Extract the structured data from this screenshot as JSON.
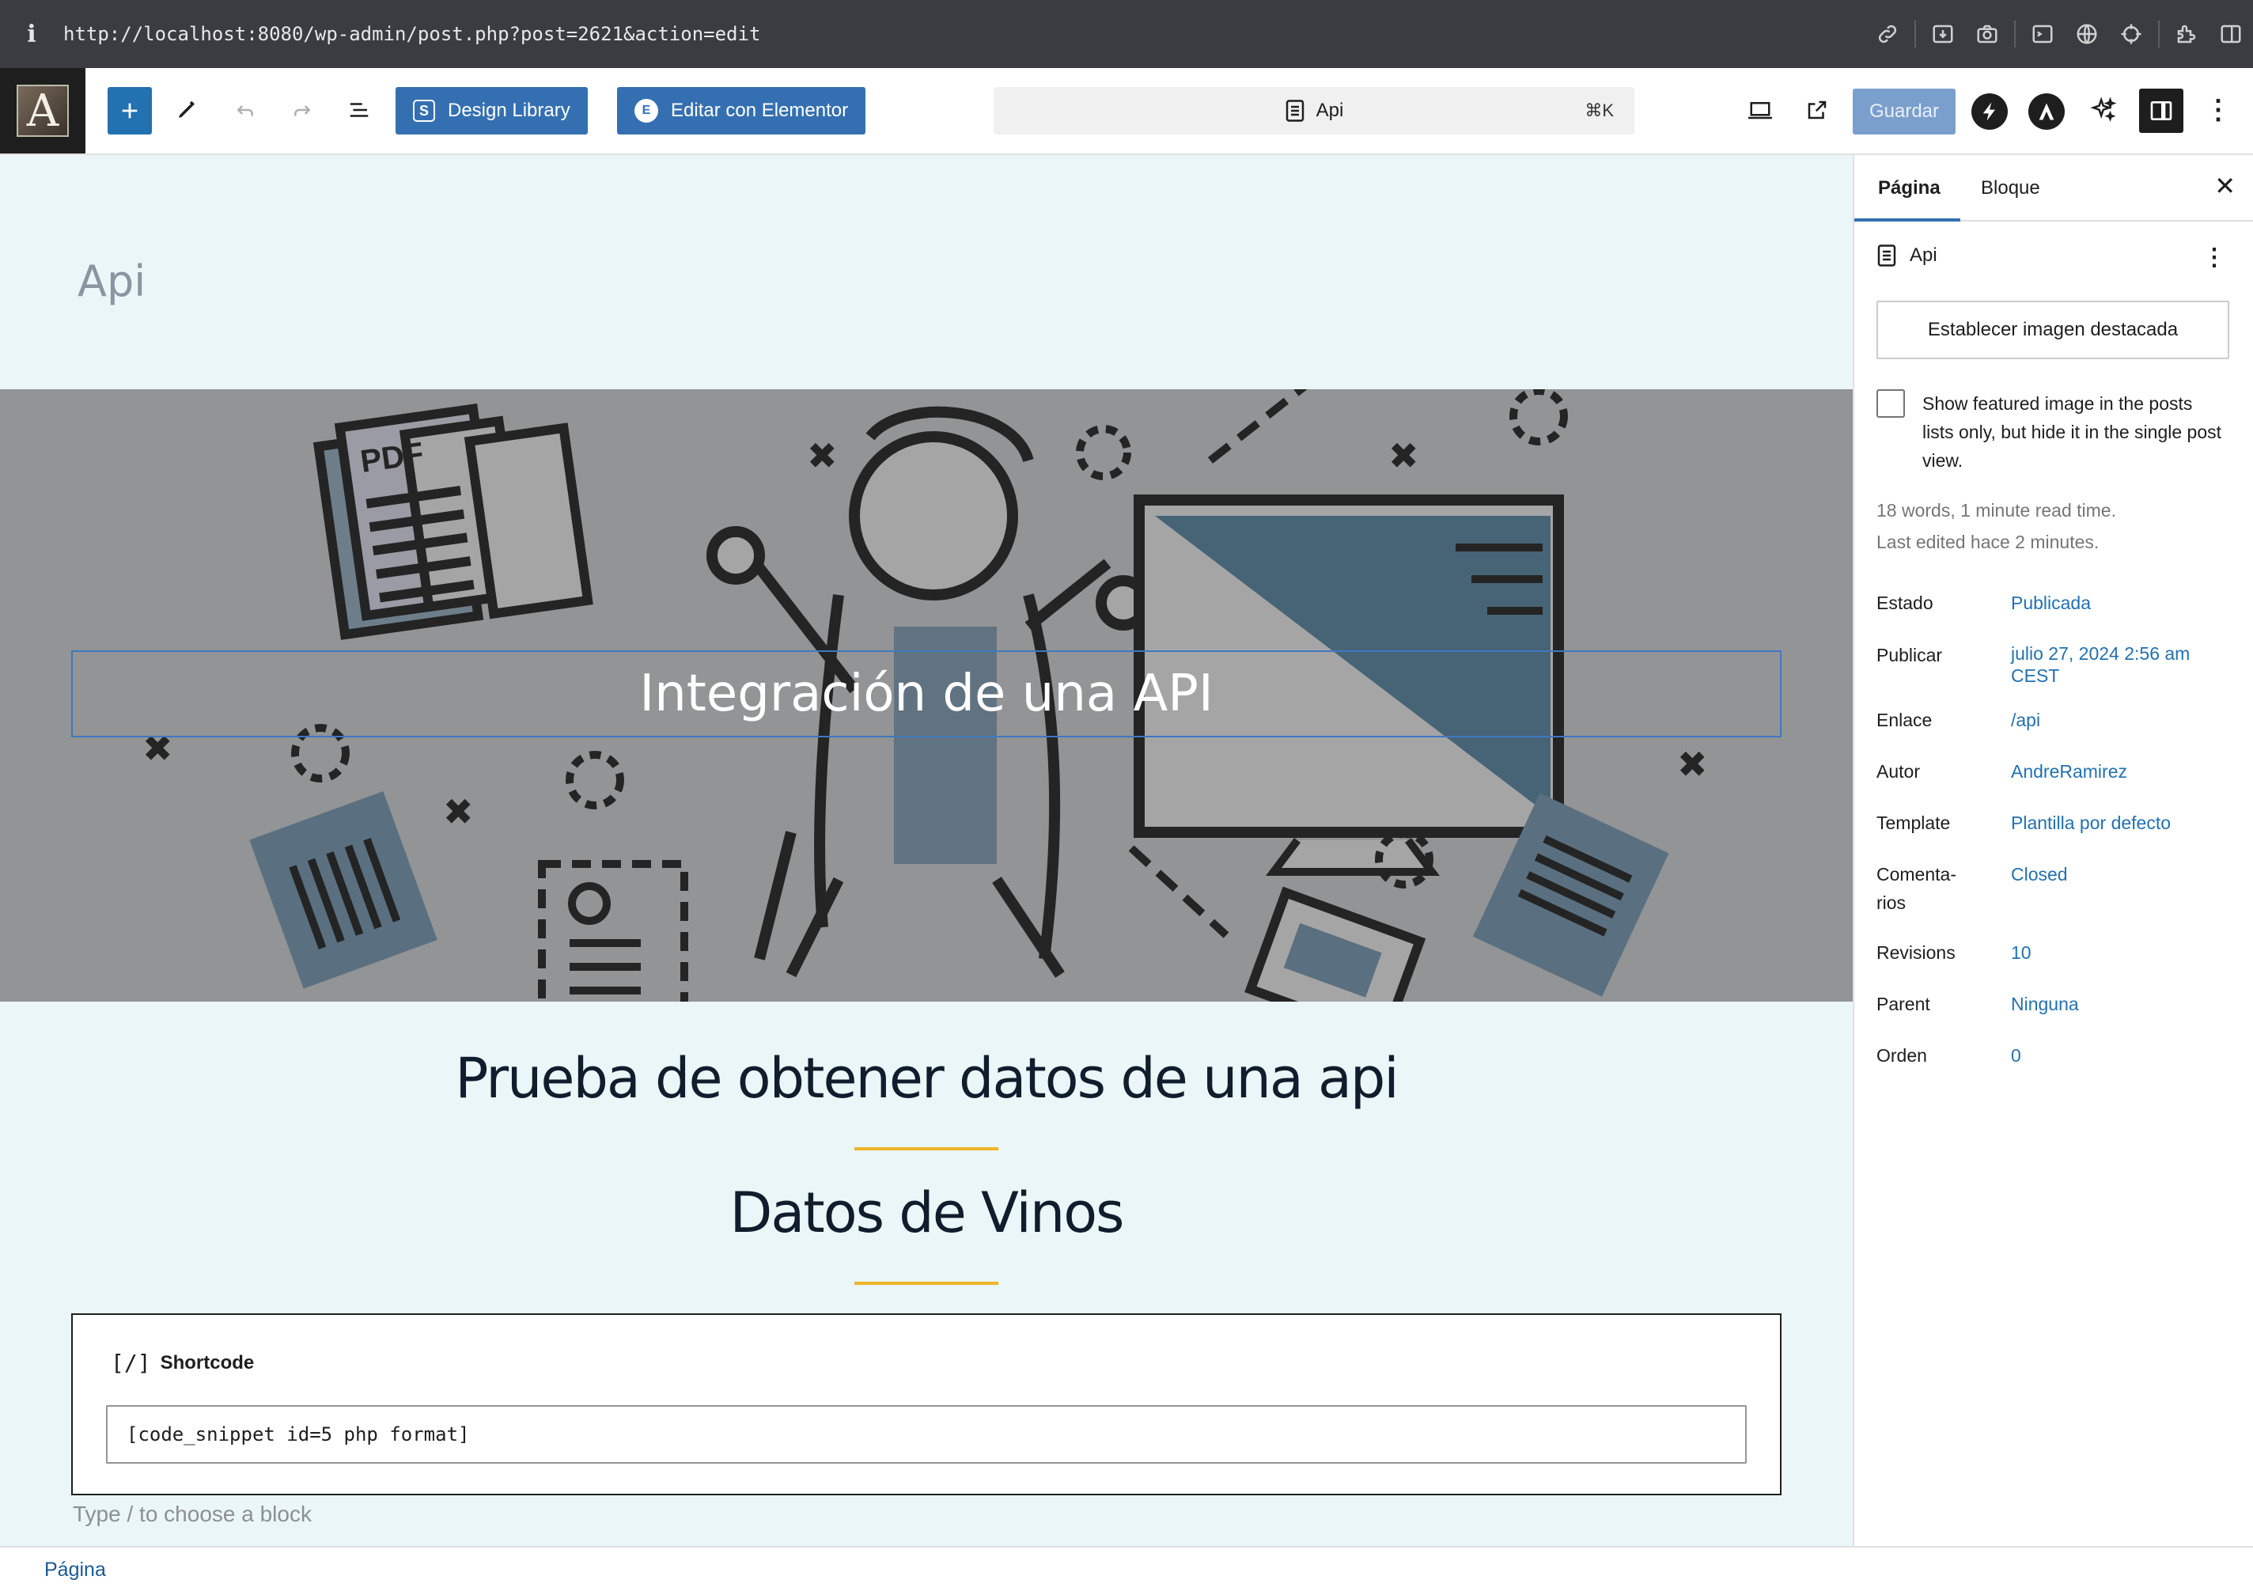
{
  "browser": {
    "info_icon": "i",
    "url": "http://localhost:8080/wp-admin/post.php?post=2621&action=edit",
    "icons": [
      "link-icon",
      "install-icon",
      "camera-icon",
      "terminal-icon",
      "globe-icon",
      "crosshair-icon",
      "extension-icon",
      "split-view-icon"
    ]
  },
  "toolbar": {
    "logo_letter": "A",
    "design_library_label": "Design Library",
    "elementor_label": "Editar con Elementor",
    "command_title": "Api",
    "command_shortcut": "⌘K",
    "save_label": "Guardar",
    "colors": {
      "primary": "#3470b1",
      "save_disabled": "#7b9fcc"
    }
  },
  "canvas": {
    "page_title": "Api",
    "cover_heading": "Integración de una API",
    "heading_1": "Prueba de obtener datos de una api",
    "heading_2": "Datos de Vinos",
    "shortcode": {
      "icon": "[/]",
      "label": "Shortcode",
      "value": "[code_snippet id=5 php format]"
    },
    "appender_placeholder": "Type / to choose a block",
    "divider_color": "#f0b428"
  },
  "sidebar": {
    "tabs": [
      {
        "label": "Página",
        "active": true
      },
      {
        "label": "Bloque",
        "active": false
      }
    ],
    "close_icon": "✕",
    "document_title": "Api",
    "featured_image_button": "Establecer imagen destacada",
    "checkbox_label": "Show featured image in the posts lists only, but hide it in the single post view.",
    "checkbox_checked": false,
    "word_count": "18 words, 1 minute read time.",
    "last_edited": "Last edited hace 2 minutes.",
    "properties": [
      {
        "key": "Estado",
        "value": "Publicada"
      },
      {
        "key": "Publicar",
        "value": "julio 27, 2024 2:56 am CEST"
      },
      {
        "key": "Enlace",
        "value": "/api"
      },
      {
        "key": "Autor",
        "value": "AndreRamirez"
      },
      {
        "key": "Template",
        "value": "Plantilla por defecto"
      },
      {
        "key": "Comenta-rios",
        "value": "Closed"
      },
      {
        "key": "Revisions",
        "value": "10"
      },
      {
        "key": "Parent",
        "value": "Ninguna"
      },
      {
        "key": "Orden",
        "value": "0"
      }
    ]
  },
  "footer": {
    "breadcrumb": "Página"
  }
}
